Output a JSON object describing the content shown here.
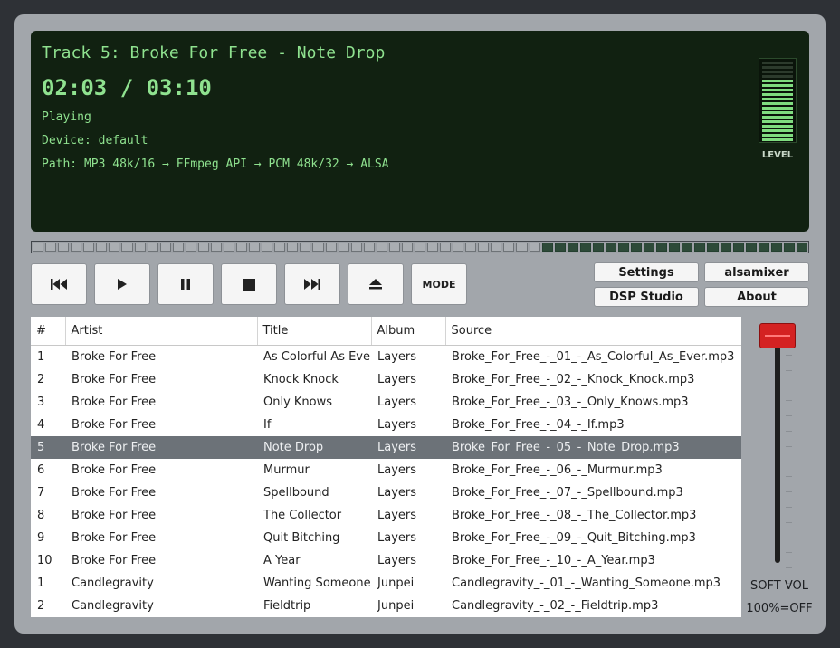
{
  "display": {
    "track_title": "Track 5: Broke For Free - Note Drop",
    "time": "02:03 / 03:10",
    "status": "Playing",
    "device": "Device: default",
    "path": "Path: MP3 48k/16 → FFmpeg API → PCM 48k/32 → ALSA",
    "level_label": "LEVEL",
    "level_fraction": 0.78
  },
  "seek": {
    "progress": 0.65
  },
  "transport": {
    "icons": [
      "previous-icon",
      "play-icon",
      "pause-icon",
      "stop-icon",
      "next-icon",
      "eject-icon"
    ],
    "mode_label": "MODE"
  },
  "side_buttons": {
    "settings": "Settings",
    "alsamixer": "alsamixer",
    "dsp_studio": "DSP Studio",
    "about": "About"
  },
  "playlist": {
    "columns": [
      "#",
      "Artist",
      "Title",
      "Album",
      "Source"
    ],
    "selected_index": 4,
    "rows": [
      [
        "1",
        "Broke For Free",
        "As Colorful As Ever",
        "Layers",
        "Broke_For_Free_-_01_-_As_Colorful_As_Ever.mp3"
      ],
      [
        "2",
        "Broke For Free",
        "Knock Knock",
        "Layers",
        "Broke_For_Free_-_02_-_Knock_Knock.mp3"
      ],
      [
        "3",
        "Broke For Free",
        "Only Knows",
        "Layers",
        "Broke_For_Free_-_03_-_Only_Knows.mp3"
      ],
      [
        "4",
        "Broke For Free",
        "If",
        "Layers",
        "Broke_For_Free_-_04_-_If.mp3"
      ],
      [
        "5",
        "Broke For Free",
        "Note Drop",
        "Layers",
        "Broke_For_Free_-_05_-_Note_Drop.mp3"
      ],
      [
        "6",
        "Broke For Free",
        "Murmur",
        "Layers",
        "Broke_For_Free_-_06_-_Murmur.mp3"
      ],
      [
        "7",
        "Broke For Free",
        "Spellbound",
        "Layers",
        "Broke_For_Free_-_07_-_Spellbound.mp3"
      ],
      [
        "8",
        "Broke For Free",
        "The Collector",
        "Layers",
        "Broke_For_Free_-_08_-_The_Collector.mp3"
      ],
      [
        "9",
        "Broke For Free",
        "Quit Bitching",
        "Layers",
        "Broke_For_Free_-_09_-_Quit_Bitching.mp3"
      ],
      [
        "10",
        "Broke For Free",
        "A Year",
        "Layers",
        "Broke_For_Free_-_10_-_A_Year.mp3"
      ],
      [
        "1",
        "Candlegravity",
        "Wanting Someone",
        "Junpei",
        "Candlegravity_-_01_-_Wanting_Someone.mp3"
      ],
      [
        "2",
        "Candlegravity",
        "Fieldtrip",
        "Junpei",
        "Candlegravity_-_02_-_Fieldtrip.mp3"
      ]
    ]
  },
  "volume": {
    "label": "SOFT VOL",
    "note": "100%=OFF",
    "level_fraction": 1.0
  },
  "colors": {
    "display_bg": "#112111",
    "display_text": "#8fe28f",
    "seek_played": "#aaaeb2",
    "seek_remaining": "#2d4a38",
    "selection": "#6c7278",
    "fader_knob": "#d42222"
  }
}
